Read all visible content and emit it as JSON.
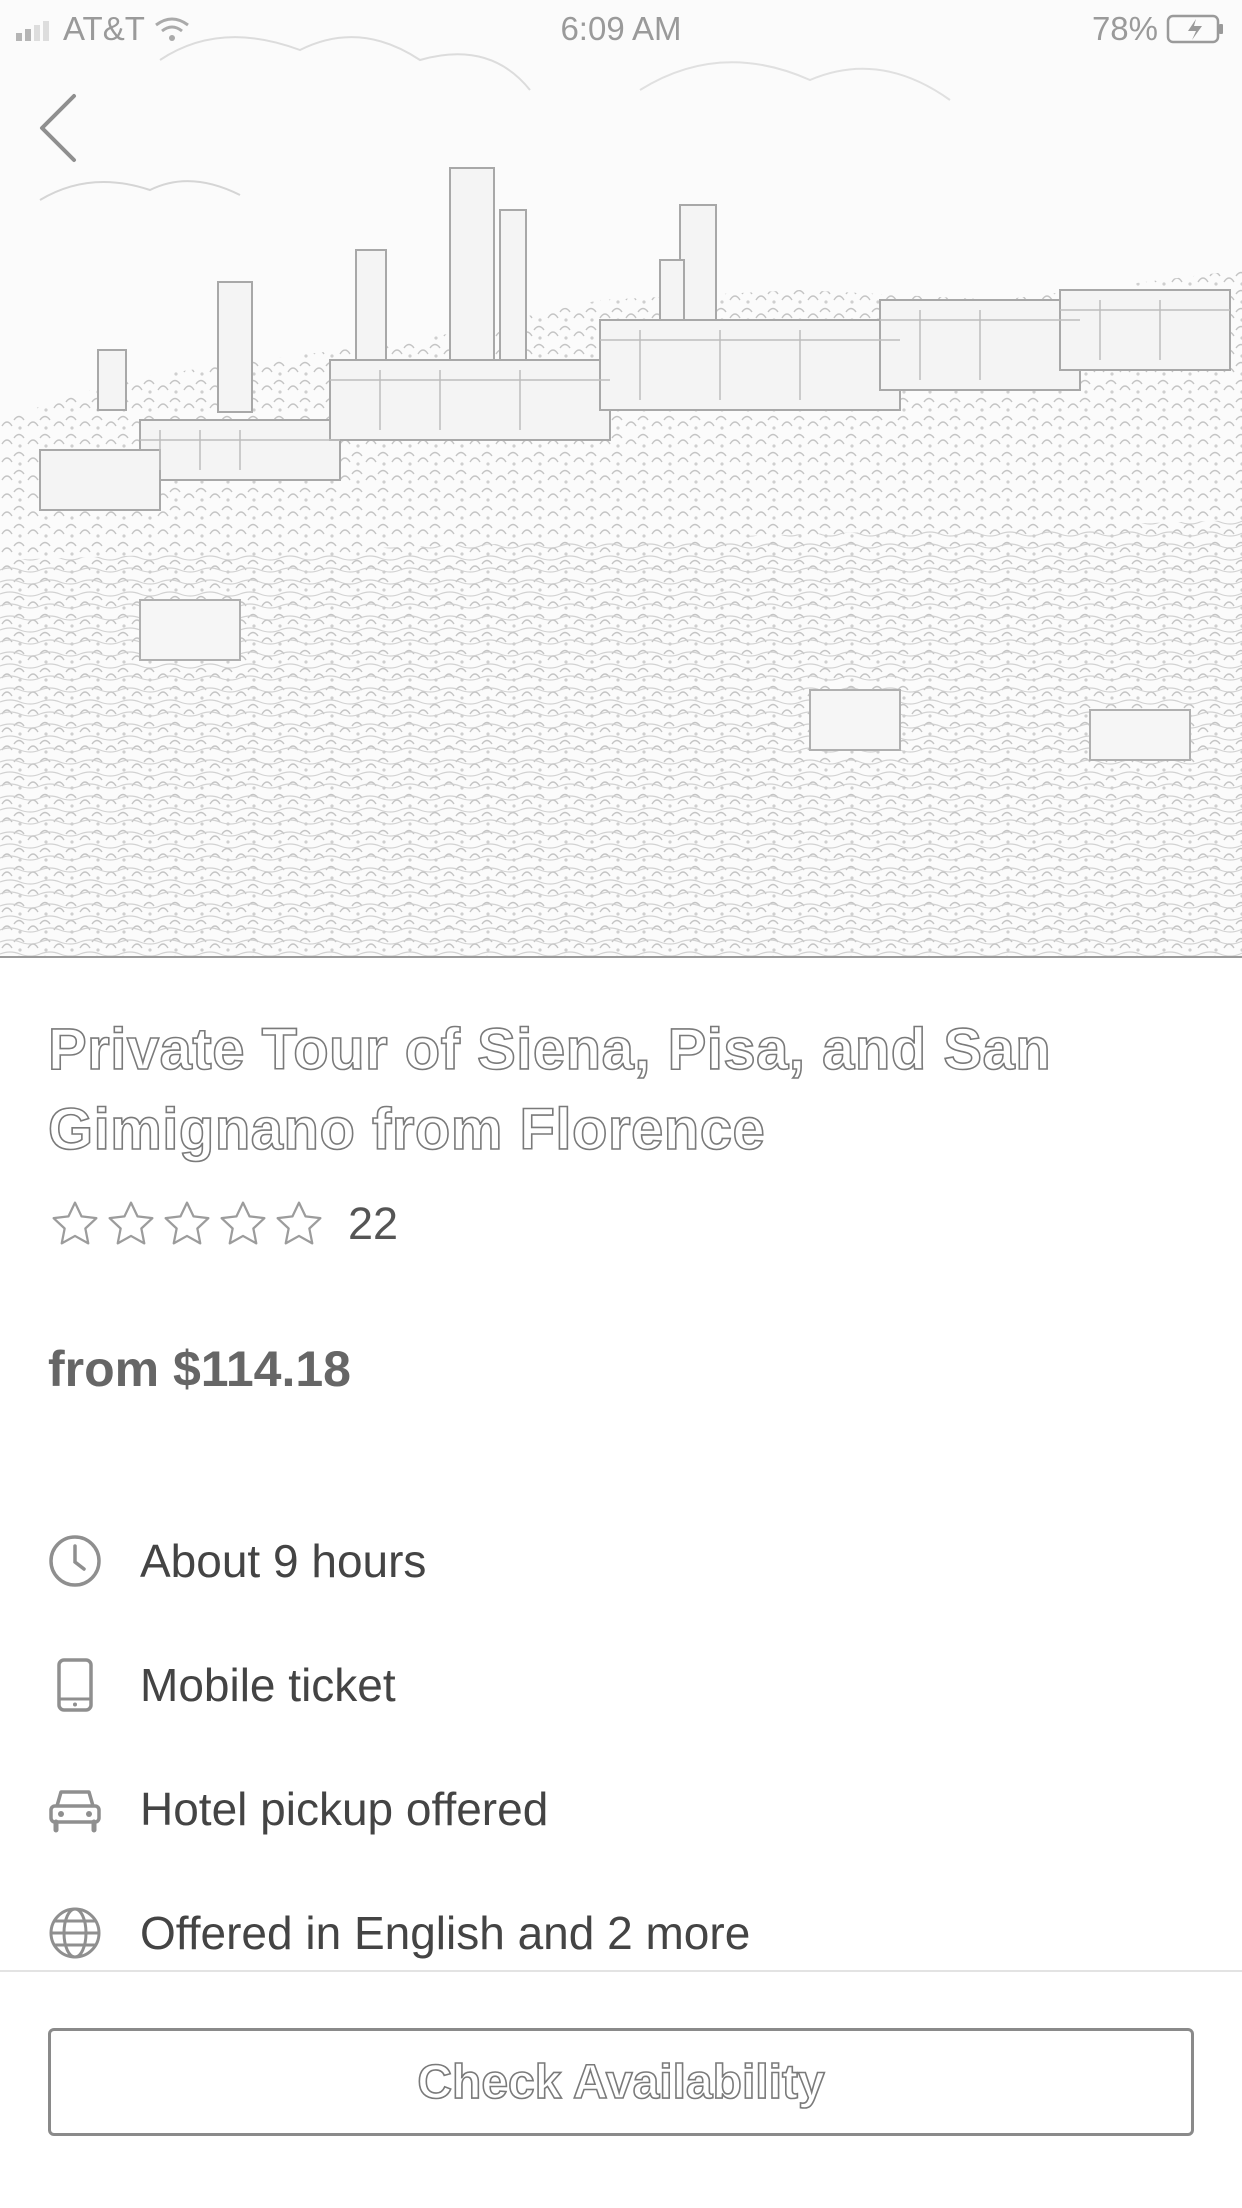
{
  "status_bar": {
    "carrier": "AT&T",
    "time": "6:09 AM",
    "battery": "78%"
  },
  "header": {
    "back_icon": "chevron-left-icon"
  },
  "product": {
    "title": "Private Tour of Siena, Pisa, and San Gimignano from Florence",
    "rating_stars": 0,
    "rating_max": 5,
    "review_count": "22",
    "price": "from $114.18"
  },
  "features": [
    {
      "icon": "clock-icon",
      "label": "About 9 hours"
    },
    {
      "icon": "mobile-phone-icon",
      "label": "Mobile ticket"
    },
    {
      "icon": "car-icon",
      "label": "Hotel pickup offered"
    },
    {
      "icon": "globe-icon",
      "label": "Offered in English and 2 more"
    }
  ],
  "cta": {
    "label": "Check Availability"
  }
}
